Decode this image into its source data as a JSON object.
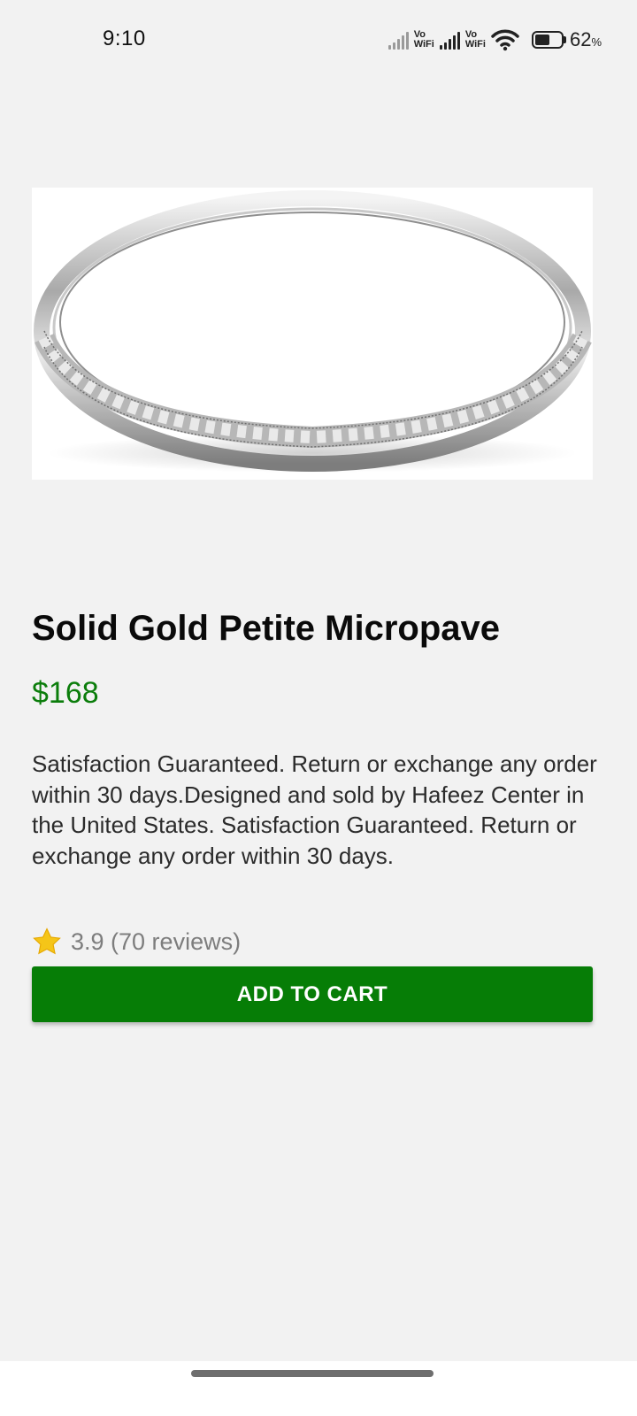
{
  "status_bar": {
    "time": "9:10",
    "vowifi_top": "Vo",
    "vowifi_bottom": "WiFi",
    "battery_percent": "62",
    "battery_suffix": "%",
    "icons": [
      "signal-icon",
      "vowifi-icon",
      "signal-icon",
      "vowifi-icon",
      "wifi-icon",
      "battery-icon"
    ]
  },
  "product": {
    "image_icon": "ring-image",
    "title": "Solid Gold Petite Micropave",
    "price": "$168",
    "description": "Satisfaction Guaranteed. Return or exchange any order within 30 days.Designed and sold by Hafeez Center in the United States. Satisfaction Guaranteed. Return or exchange any order within 30 days.",
    "rating": "3.9 (70 reviews)",
    "rating_icon": "star-icon"
  },
  "actions": {
    "add_to_cart_label": "ADD TO CART"
  },
  "colors": {
    "accent_green": "#067d06",
    "price_green": "#0b7d0b",
    "star_yellow": "#f5c518",
    "background": "#f2f2f2"
  }
}
